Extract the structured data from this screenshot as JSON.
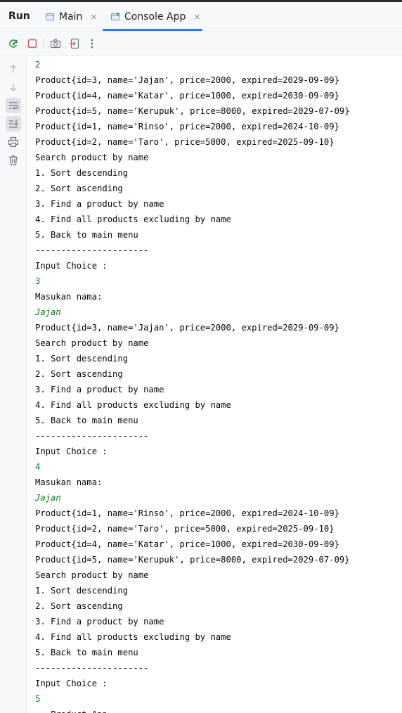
{
  "header": {
    "run_title": "Run",
    "tabs": [
      {
        "label": "Main",
        "icon": "window-icon"
      },
      {
        "label": "Console App",
        "icon": "app-window-icon"
      }
    ],
    "close_glyph": "×"
  },
  "toolbar": {
    "buttons": [
      "rerun-icon",
      "stop-icon",
      "camera-icon",
      "exit-icon",
      "more-icon"
    ]
  },
  "gutter": {
    "buttons": [
      "arrow-up-icon",
      "arrow-down-icon",
      "soft-wrap-icon",
      "scroll-to-end-icon",
      "print-icon",
      "trash-icon"
    ]
  },
  "colors": {
    "accent": "#3574f0",
    "input_text": "#067d17",
    "stop_red": "#e55765",
    "rerun_green": "#208a3c"
  },
  "console": {
    "lines": [
      {
        "text": "2",
        "type": "input"
      },
      {
        "text": "Product{id=3, name='Jajan', price=2000, expired=2029-09-09}",
        "type": "output"
      },
      {
        "text": "Product{id=4, name='Katar', price=1000, expired=2030-09-09}",
        "type": "output"
      },
      {
        "text": "Product{id=5, name='Kerupuk', price=8000, expired=2029-07-09}",
        "type": "output"
      },
      {
        "text": "Product{id=1, name='Rinso', price=2000, expired=2024-10-09}",
        "type": "output"
      },
      {
        "text": "Product{id=2, name='Taro', price=5000, expired=2025-09-10}",
        "type": "output"
      },
      {
        "text": "Search product by name",
        "type": "output"
      },
      {
        "text": "1. Sort descending",
        "type": "output"
      },
      {
        "text": "2. Sort ascending",
        "type": "output"
      },
      {
        "text": "3. Find a product by name",
        "type": "output"
      },
      {
        "text": "4. Find all products excluding by name",
        "type": "output"
      },
      {
        "text": "5. Back to main menu",
        "type": "output"
      },
      {
        "text": "----------------------",
        "type": "output"
      },
      {
        "text": "Input Choice :",
        "type": "output"
      },
      {
        "text": "3",
        "type": "input"
      },
      {
        "text": "Masukan nama:",
        "type": "output"
      },
      {
        "text": "Jajan",
        "type": "input-italic"
      },
      {
        "text": "Product{id=3, name='Jajan', price=2000, expired=2029-09-09}",
        "type": "output"
      },
      {
        "text": "Search product by name",
        "type": "output"
      },
      {
        "text": "1. Sort descending",
        "type": "output"
      },
      {
        "text": "2. Sort ascending",
        "type": "output"
      },
      {
        "text": "3. Find a product by name",
        "type": "output"
      },
      {
        "text": "4. Find all products excluding by name",
        "type": "output"
      },
      {
        "text": "5. Back to main menu",
        "type": "output"
      },
      {
        "text": "----------------------",
        "type": "output"
      },
      {
        "text": "Input Choice :",
        "type": "output"
      },
      {
        "text": "4",
        "type": "input"
      },
      {
        "text": "Masukan nama:",
        "type": "output"
      },
      {
        "text": "Jajan",
        "type": "input-italic"
      },
      {
        "text": "Product{id=1, name='Rinso', price=2000, expired=2024-10-09}",
        "type": "output"
      },
      {
        "text": "Product{id=2, name='Taro', price=5000, expired=2025-09-10}",
        "type": "output"
      },
      {
        "text": "Product{id=4, name='Katar', price=1000, expired=2030-09-09}",
        "type": "output"
      },
      {
        "text": "Product{id=5, name='Kerupuk', price=8000, expired=2029-07-09}",
        "type": "output"
      },
      {
        "text": "Search product by name",
        "type": "output"
      },
      {
        "text": "1. Sort descending",
        "type": "output"
      },
      {
        "text": "2. Sort ascending",
        "type": "output"
      },
      {
        "text": "3. Find a product by name",
        "type": "output"
      },
      {
        "text": "4. Find all products excluding by name",
        "type": "output"
      },
      {
        "text": "5. Back to main menu",
        "type": "output"
      },
      {
        "text": "----------------------",
        "type": "output"
      },
      {
        "text": "Input Choice :",
        "type": "output"
      },
      {
        "text": "5",
        "type": "input"
      },
      {
        "text": "---Product App---",
        "type": "output"
      }
    ]
  }
}
